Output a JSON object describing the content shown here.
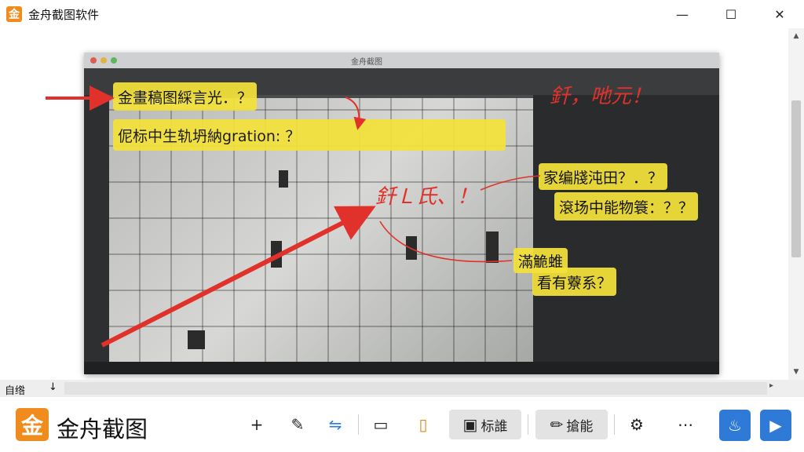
{
  "window": {
    "badge": "金",
    "title": "金舟截图软件",
    "minimize_glyph": "—",
    "maximize_glyph": "☐",
    "close_glyph": "✕"
  },
  "canvas": {
    "shot_title": "金舟截图",
    "callouts": [
      "金畫稿图綵言光．？",
      "伲标中生轨坍納gration: ？",
      "家编牋沌田？．？",
      "滾场中能物簑：？？",
      "滿觤蜼",
      "看有藔系？"
    ],
    "handwriting": [
      "釺，吔元！",
      "釺Ｌ氏、！"
    ]
  },
  "status": {
    "text": "自绺",
    "arrow": "↓",
    "right_arrow": "▸"
  },
  "bottom": {
    "logo": "金",
    "brand": "金舟截图",
    "tools": {
      "crosshair": "+",
      "edit": "✎",
      "tag": "⇋",
      "comment": "▭",
      "document": "▯",
      "label_tool": "标誰",
      "smart_tool": "搶能",
      "settings": "⚙",
      "more": "⋯"
    },
    "fire": "♨",
    "play": "▶"
  },
  "colors": {
    "brand": "#f08c1e",
    "highlight": "#f4e23a",
    "arrow_red": "#e0322a",
    "play_blue": "#2e7ad6"
  }
}
